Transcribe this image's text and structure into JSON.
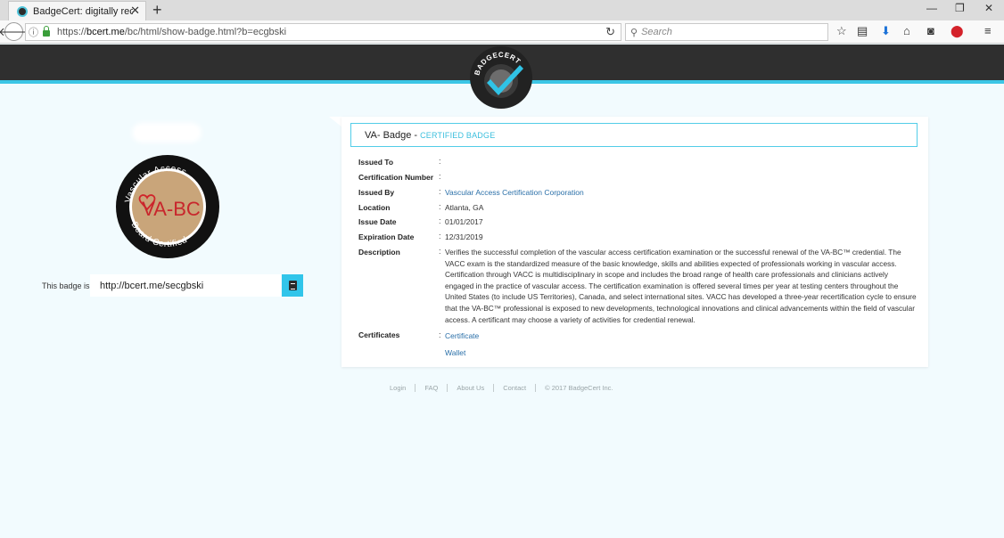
{
  "browser": {
    "tab_title": "BadgeCert: digitally recogni",
    "tab_close": "✕",
    "new_tab": "+",
    "url_prefix": "https://",
    "url_domain": "bcert.me",
    "url_path": "/bc/html/show-badge.html?b=ecgbski",
    "search_placeholder": "Search",
    "window_controls": [
      "—",
      "❐",
      "✕"
    ]
  },
  "site": {
    "logo_text": "BADGECERT",
    "brand_color": "#3cc6e6"
  },
  "badge_image": {
    "top_text": "Vascular Access",
    "center_text": "VA-BC",
    "bottom_text": "Board Certified"
  },
  "share": {
    "label": "This badge is",
    "url": "http://bcert.me/secgbski"
  },
  "card": {
    "title": "VA- Badge",
    "separator": "-",
    "subtitle": "CERTIFIED BADGE",
    "fields": [
      {
        "label": "Issued To",
        "colon": ":",
        "value": ""
      },
      {
        "label": "Certification Number",
        "colon": ":",
        "value": ""
      },
      {
        "label": "Issued By",
        "colon": ":",
        "value": "Vascular Access Certification Corporation"
      },
      {
        "label": "Location",
        "colon": ":",
        "value": "Atlanta, GA"
      },
      {
        "label": "Issue Date",
        "colon": ":",
        "value": "01/01/2017"
      },
      {
        "label": "Expiration Date",
        "colon": ":",
        "value": "12/31/2019"
      },
      {
        "label": "Description",
        "colon": ":",
        "value": "Verifies the successful completion of the vascular access certification examination or the successful renewal of the VA-BC™ credential. The VACC exam is the standardized measure of the basic knowledge, skills and abilities expected of professionals working in vascular access. Certification through VACC is multidisciplinary in scope and includes the broad range of health care professionals and clinicians actively engaged in the practice of vascular access. The certification examination is offered several times per year at testing centers throughout the United States (to include US Territories), Canada, and select international sites. VACC has developed a three-year recertification cycle to ensure that the VA-BC™ professional is exposed to new developments, technological innovations and clinical advancements within the field of vascular access. A certificant may choose a variety of activities for credential renewal."
      },
      {
        "label": "Certificates",
        "colon": ":",
        "value": "Certificate"
      }
    ],
    "wallet": "Wallet"
  },
  "footer": {
    "links": [
      "Login",
      "FAQ",
      "About Us",
      "Contact"
    ],
    "copyright": "© 2017 BadgeCert Inc."
  }
}
